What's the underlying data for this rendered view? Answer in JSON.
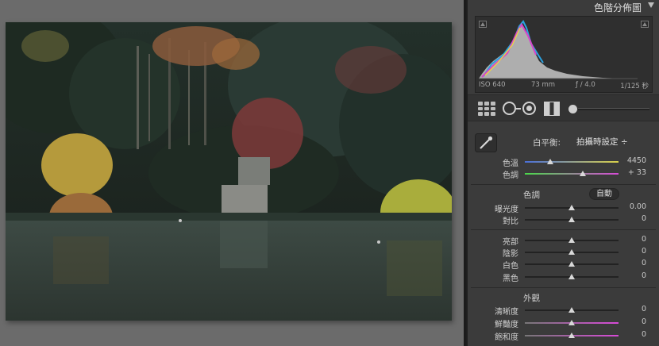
{
  "panel": {
    "title": "色階分佈圖",
    "histogram": {
      "iso": "ISO 640",
      "focal_length": "73 mm",
      "aperture": "ƒ / 4.0",
      "shutter": "1/125 秒"
    },
    "white_balance": {
      "label": "白平衡:",
      "value": "拍攝時設定 ÷"
    },
    "temp": {
      "label": "色溫",
      "value": "4450",
      "level": 0.27
    },
    "tint": {
      "label": "色調",
      "value": "+ 33",
      "level": 0.62
    },
    "tone": {
      "title": "色調",
      "auto_label": "自動",
      "exposure": {
        "label": "曝光度",
        "value": "0.00",
        "level": 0.5
      },
      "contrast": {
        "label": "對比",
        "value": "0",
        "level": 0.5
      },
      "highlights": {
        "label": "亮部",
        "value": "0",
        "level": 0.5
      },
      "shadows": {
        "label": "陰影",
        "value": "0",
        "level": 0.5
      },
      "whites": {
        "label": "白色",
        "value": "0",
        "level": 0.5
      },
      "blacks": {
        "label": "黑色",
        "value": "0",
        "level": 0.5
      }
    },
    "presence": {
      "title": "外觀",
      "clarity": {
        "label": "清晰度",
        "value": "0",
        "level": 0.5
      },
      "vibrance": {
        "label": "鮮豔度",
        "value": "0",
        "level": 0.5
      },
      "saturation": {
        "label": "飽和度",
        "value": "0",
        "level": 0.5
      }
    }
  },
  "colors": {
    "panel_bg": "#3b3b3b",
    "canvas_bg": "#6b6b6b",
    "temp_track_start": "#4a6fd8",
    "temp_track_end": "#d8d04a",
    "tint_track_start": "#4ad84a",
    "tint_track_end": "#d84ad8"
  }
}
